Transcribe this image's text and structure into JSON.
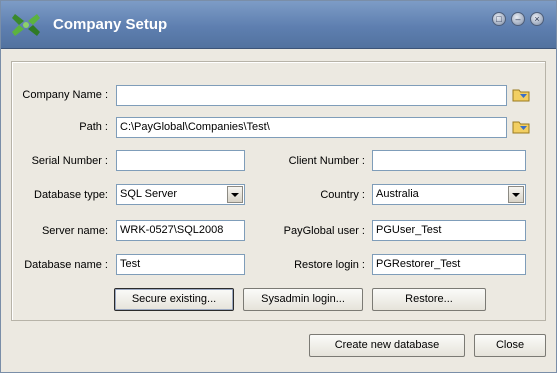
{
  "window": {
    "title": "Company Setup",
    "controls": [
      "restore-icon",
      "minimize-icon",
      "close-icon"
    ]
  },
  "form": {
    "company_name": {
      "label": "Company Name :",
      "value": ""
    },
    "path": {
      "label": "Path :",
      "value": "C:\\PayGlobal\\Companies\\Test\\"
    },
    "serial_number": {
      "label": "Serial Number :",
      "value": ""
    },
    "client_number": {
      "label": "Client Number :",
      "value": ""
    },
    "database_type": {
      "label": "Database type:",
      "value": "SQL Server"
    },
    "country": {
      "label": "Country :",
      "value": "Australia"
    },
    "server_name": {
      "label": "Server name:",
      "value": "WRK-0527\\SQL2008"
    },
    "payglobal_user": {
      "label": "PayGlobal user :",
      "value": "PGUser_Test"
    },
    "database_name": {
      "label": "Database name :",
      "value": "Test"
    },
    "restore_login": {
      "label": "Restore login :",
      "value": "PGRestorer_Test"
    }
  },
  "buttons": {
    "secure_existing": "Secure existing...",
    "sysadmin_login": "Sysadmin login...",
    "restore": "Restore...",
    "create_new_database": "Create new database",
    "close": "Close"
  },
  "colors": {
    "title_bar": "#5e7fb0",
    "window_bg": "#ece9e1",
    "input_border": "#7f9db9"
  }
}
